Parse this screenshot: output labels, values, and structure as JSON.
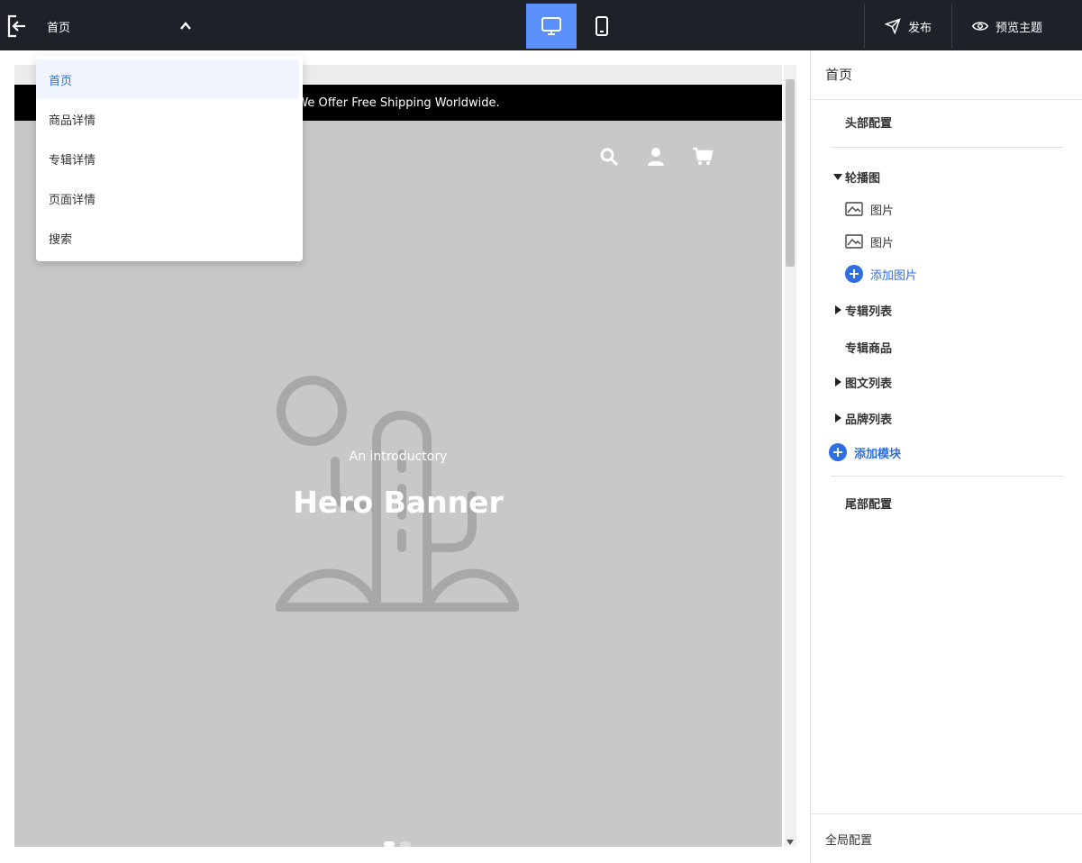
{
  "topbar": {
    "exit_icon": "exit-icon",
    "page_select": {
      "value": "首页",
      "icon": "chevron-up-icon"
    },
    "devices": [
      {
        "name": "desktop",
        "icon": "monitor-icon",
        "active": true
      },
      {
        "name": "mobile",
        "icon": "phone-icon",
        "active": false
      }
    ],
    "actions": [
      {
        "label": "发布",
        "icon": "send-icon"
      },
      {
        "label": "预览主题",
        "icon": "eye-icon"
      }
    ]
  },
  "dropdown": {
    "items": [
      {
        "label": "首页",
        "selected": true
      },
      {
        "label": "商品详情",
        "selected": false
      },
      {
        "label": "专辑详情",
        "selected": false
      },
      {
        "label": "页面详情",
        "selected": false
      },
      {
        "label": "搜索",
        "selected": false
      }
    ]
  },
  "preview": {
    "announcement": "We Offer Free Shipping Worldwide.",
    "store_icons": [
      "search-icon",
      "user-icon",
      "cart-icon"
    ],
    "hero": {
      "subtitle": "An introductory",
      "title": "Hero Banner",
      "art": "cactus-icon"
    }
  },
  "side_panel": {
    "title": "首页",
    "header_config": "头部配置",
    "modules": {
      "carousel": {
        "label": "轮播图",
        "expanded": true,
        "children": [
          "图片",
          "图片"
        ],
        "add_label": "添加图片"
      },
      "album_list": {
        "label": "专辑列表",
        "expanded": false
      },
      "album_products": {
        "label": "专辑商品"
      },
      "image_text_list": {
        "label": "图文列表",
        "expanded": false
      },
      "brand_list": {
        "label": "品牌列表",
        "expanded": false
      }
    },
    "add_module": "添加模块",
    "footer_config": "尾部配置",
    "global_config": "全局配置"
  },
  "colors": {
    "topbar": "#1f2129",
    "accent": "#5b8ff9",
    "link": "#2f6fe4",
    "preview_bg": "#c8c8c8"
  }
}
